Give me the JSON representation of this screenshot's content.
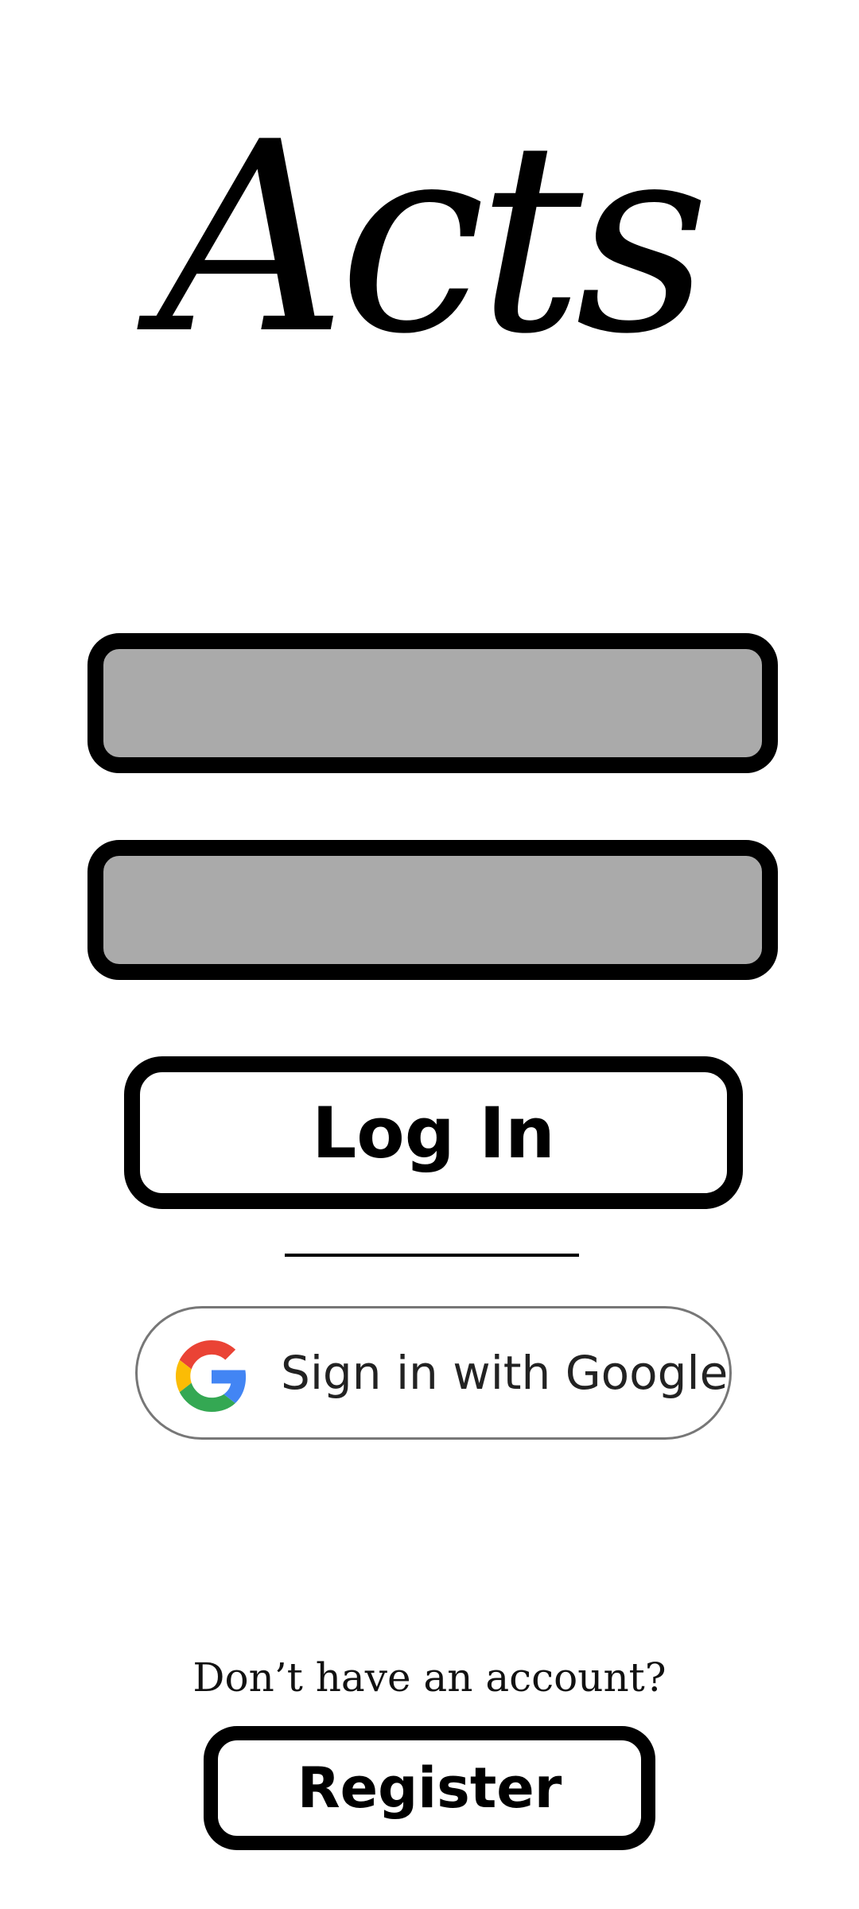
{
  "app": {
    "logo_text": "Acts"
  },
  "form": {
    "field_1": {
      "value": "",
      "placeholder": ""
    },
    "field_2": {
      "value": "",
      "placeholder": ""
    },
    "login_label": "Log In"
  },
  "google": {
    "label": "Sign in with Google",
    "icon": "google-g-icon",
    "colors": {
      "blue": "#4285F4",
      "red": "#EA4335",
      "yellow": "#FBBC05",
      "green": "#34A853"
    }
  },
  "footer": {
    "prompt": "Don’t have an account?",
    "register_label": "Register"
  },
  "colors": {
    "field_fill": "#aaaaaa",
    "border": "#000000",
    "background": "#ffffff"
  }
}
